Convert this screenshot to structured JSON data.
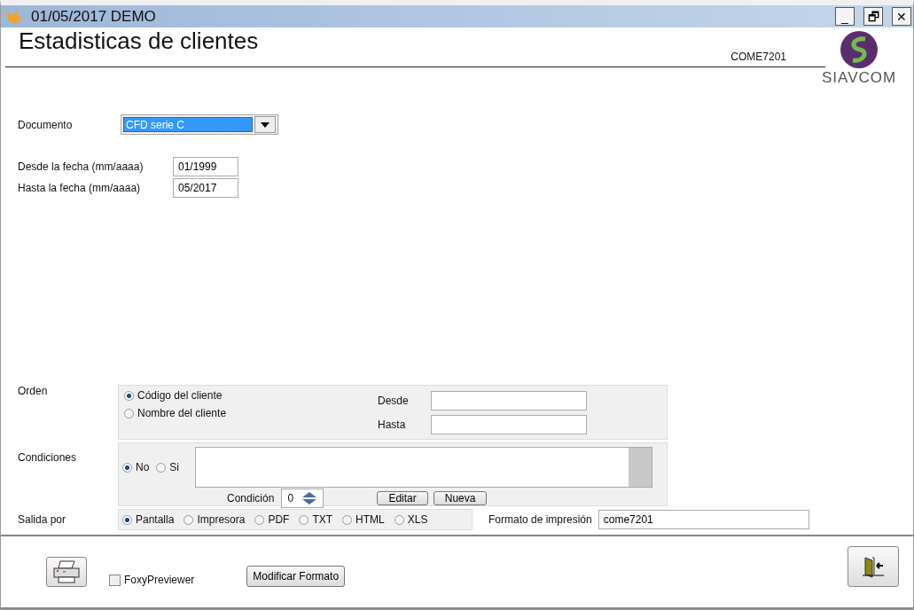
{
  "window": {
    "title": "01/05/2017  DEMO",
    "controls": [
      "_",
      "🗗",
      "✕"
    ]
  },
  "header": {
    "title": "Estadisticas de clientes",
    "code": "COME7201",
    "logo_text": "SIAVCOM"
  },
  "documento": {
    "label": "Documento",
    "value": "CFD serie C"
  },
  "dates": [
    {
      "label": "Desde la fecha (mm/aaaa)",
      "value": "01/1999"
    },
    {
      "label": "Hasta la fecha (mm/aaaa)",
      "value": "05/2017"
    }
  ],
  "orden": {
    "label": "Orden",
    "options": [
      {
        "label": "Código del cliente",
        "selected": true
      },
      {
        "label": "Nombre del cliente",
        "selected": false
      }
    ],
    "desde_label": "Desde",
    "hasta_label": "Hasta"
  },
  "condiciones": {
    "label": "Condiciones",
    "options": [
      {
        "label": "No",
        "selected": true
      },
      {
        "label": "Si",
        "selected": false
      }
    ],
    "condicion_label": "Condición",
    "condicion_value": "0",
    "buttons": [
      "Editar",
      "Nueva"
    ]
  },
  "salida": {
    "label": "Salida por",
    "options": [
      {
        "label": "Pantalla",
        "selected": true
      },
      {
        "label": "Impresora",
        "selected": false
      },
      {
        "label": "PDF",
        "selected": false
      },
      {
        "label": "TXT",
        "selected": false
      },
      {
        "label": "HTML",
        "selected": false
      },
      {
        "label": "XLS",
        "selected": false
      }
    ],
    "formato_label": "Formato de impresión",
    "formato_value": "come7201"
  },
  "footer": {
    "foxy": {
      "label": "FoxyPreviewer",
      "checked": false
    },
    "modify_button": "Modificar Formato"
  }
}
